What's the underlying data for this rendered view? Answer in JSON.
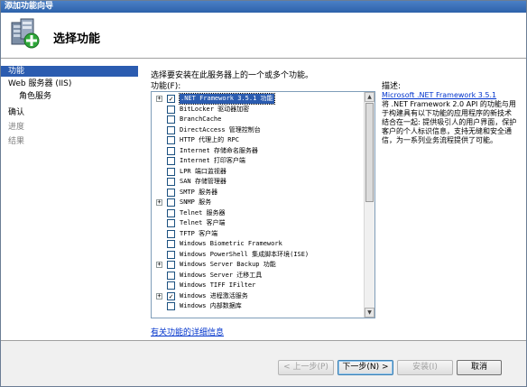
{
  "window": {
    "title": "添加功能向导"
  },
  "header": {
    "title": "选择功能"
  },
  "nav": {
    "items": [
      {
        "label": "功能",
        "state": "active"
      },
      {
        "label": "Web 服务器 (IIS)",
        "state": "normal"
      },
      {
        "label": "角色服务",
        "state": "sub"
      },
      {
        "label": "确认",
        "state": "normal"
      },
      {
        "label": "进度",
        "state": "disabled"
      },
      {
        "label": "结果",
        "state": "disabled"
      }
    ]
  },
  "content": {
    "instruction": "选择要安装在此服务器上的一个或多个功能。",
    "features_label": "功能(F):",
    "description_label": "描述:",
    "description_link": "Microsoft .NET Framework 3.5.1",
    "description_text": "将 .NET Framework 2.0 API 的功能与用于构建具有以下功能的应用程序的新技术结合在一起: 提供吸引人的用户界面，保护客户的个人标识信息，支持无缝和安全通信，为一系列业务流程提供了可能。",
    "more_info_link": "有关功能的详细信息"
  },
  "features": [
    {
      "label": ".NET Framework 3.5.1 功能",
      "checked": true,
      "expandable": true,
      "selected": true
    },
    {
      "label": "BitLocker 驱动器加密",
      "checked": false,
      "expandable": false,
      "selected": false
    },
    {
      "label": "BranchCache",
      "checked": false,
      "expandable": false,
      "selected": false
    },
    {
      "label": "DirectAccess 管理控制台",
      "checked": false,
      "expandable": false,
      "selected": false
    },
    {
      "label": "HTTP 代理上的 RPC",
      "checked": false,
      "expandable": false,
      "selected": false
    },
    {
      "label": "Internet 存储命名服务器",
      "checked": false,
      "expandable": false,
      "selected": false
    },
    {
      "label": "Internet 打印客户端",
      "checked": false,
      "expandable": false,
      "selected": false
    },
    {
      "label": "LPR 端口监视器",
      "checked": false,
      "expandable": false,
      "selected": false
    },
    {
      "label": "SAN 存储管理器",
      "checked": false,
      "expandable": false,
      "selected": false
    },
    {
      "label": "SMTP 服务器",
      "checked": false,
      "expandable": false,
      "selected": false
    },
    {
      "label": "SNMP 服务",
      "checked": false,
      "expandable": true,
      "selected": false
    },
    {
      "label": "Telnet 服务器",
      "checked": false,
      "expandable": false,
      "selected": false
    },
    {
      "label": "Telnet 客户端",
      "checked": false,
      "expandable": false,
      "selected": false
    },
    {
      "label": "TFTP 客户端",
      "checked": false,
      "expandable": false,
      "selected": false
    },
    {
      "label": "Windows Biometric Framework",
      "checked": false,
      "expandable": false,
      "selected": false
    },
    {
      "label": "Windows PowerShell 集成脚本环境(ISE)",
      "checked": false,
      "expandable": false,
      "selected": false
    },
    {
      "label": "Windows Server Backup 功能",
      "checked": false,
      "expandable": true,
      "selected": false
    },
    {
      "label": "Windows Server 迁移工具",
      "checked": false,
      "expandable": false,
      "selected": false
    },
    {
      "label": "Windows TIFF IFilter",
      "checked": false,
      "expandable": false,
      "selected": false
    },
    {
      "label": "Windows 进程激活服务",
      "checked": true,
      "expandable": true,
      "selected": false
    },
    {
      "label": "Windows 内部数据库",
      "checked": false,
      "expandable": false,
      "selected": false
    }
  ],
  "buttons": {
    "back": "< 上一步(P)",
    "next": "下一步(N) >",
    "install": "安装(I)",
    "cancel": "取消"
  },
  "colors": {
    "titlebar": "#2d62aa",
    "selection": "#2b5cb0",
    "link": "#0033cc"
  }
}
